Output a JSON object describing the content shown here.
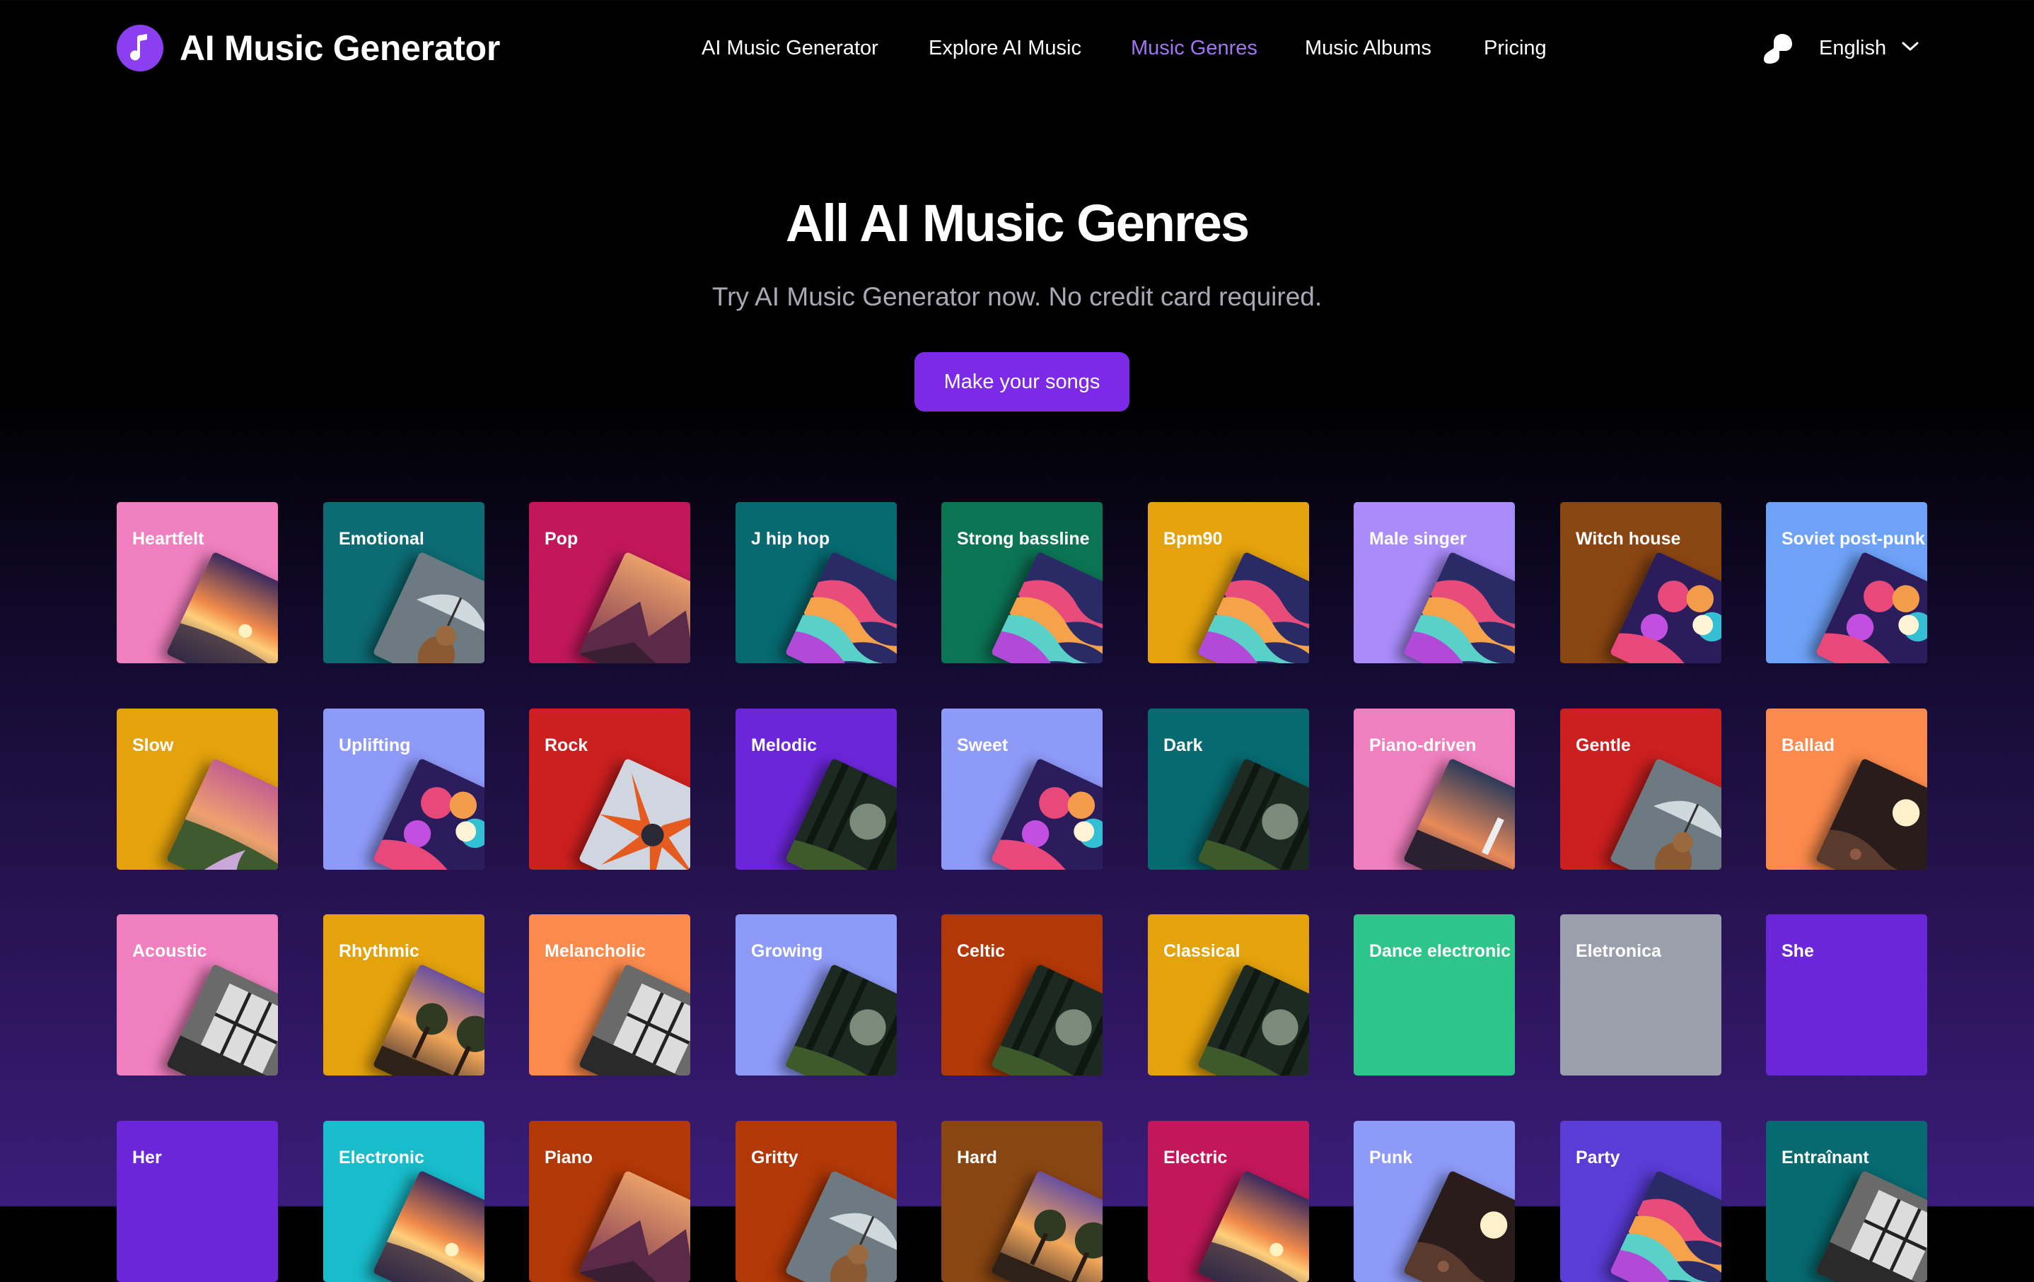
{
  "header": {
    "brand": "AI Music Generator",
    "nav": [
      {
        "label": "AI Music Generator",
        "active": false
      },
      {
        "label": "Explore AI Music",
        "active": false
      },
      {
        "label": "Music Genres",
        "active": true
      },
      {
        "label": "Music Albums",
        "active": false
      },
      {
        "label": "Pricing",
        "active": false
      }
    ],
    "language": "English"
  },
  "hero": {
    "title": "All AI Music Genres",
    "subtitle": "Try AI Music Generator now. No credit card required.",
    "cta_label": "Make your songs"
  },
  "genres": [
    {
      "label": "Heartfelt",
      "color": "#f07fbf",
      "art": "sunset-beach"
    },
    {
      "label": "Emotional",
      "color": "#0c6b73",
      "art": "dog-umbrella"
    },
    {
      "label": "Pop",
      "color": "#c2185b",
      "art": "mountain-sunset"
    },
    {
      "label": "J hip hop",
      "color": "#066a70",
      "art": "wavy-landscape"
    },
    {
      "label": "Strong bassline",
      "color": "#0b7553",
      "art": "wavy-landscape"
    },
    {
      "label": "Bpm90",
      "color": "#e4a20c",
      "art": "wavy-landscape"
    },
    {
      "label": "Male singer",
      "color": "#a98bfa",
      "art": "wavy-landscape"
    },
    {
      "label": "Witch house",
      "color": "#8a4612",
      "art": "balloons-moon"
    },
    {
      "label": "Soviet post-punk",
      "color": "#6ea2f8",
      "art": "balloons-moon"
    },
    {
      "label": "Slow",
      "color": "#e4a20c",
      "art": "meadow-river"
    },
    {
      "label": "Uplifting",
      "color": "#8e9af8",
      "art": "balloons-moon"
    },
    {
      "label": "Rock",
      "color": "#cc1f1f",
      "art": "abstract-burst"
    },
    {
      "label": "Melodic",
      "color": "#6c26da",
      "art": "forest"
    },
    {
      "label": "Sweet",
      "color": "#8e9af8",
      "art": "balloons-moon"
    },
    {
      "label": "Dark",
      "color": "#066a70",
      "art": "forest"
    },
    {
      "label": "Piano-driven",
      "color": "#f07fbf",
      "art": "lighthouse"
    },
    {
      "label": "Gentle",
      "color": "#cc1f1f",
      "art": "dog-umbrella"
    },
    {
      "label": "Ballad",
      "color": "#fb8a4c",
      "art": "moon-rocks"
    },
    {
      "label": "Acoustic",
      "color": "#f07fbf",
      "art": "bw-window"
    },
    {
      "label": "Rhythmic",
      "color": "#e4a20c",
      "art": "sunset-trees"
    },
    {
      "label": "Melancholic",
      "color": "#fb8a4c",
      "art": "bw-window"
    },
    {
      "label": "Growing",
      "color": "#8e9af8",
      "art": "forest"
    },
    {
      "label": "Celtic",
      "color": "#b23807",
      "art": "forest"
    },
    {
      "label": "Classical",
      "color": "#e4a20c",
      "art": "forest"
    },
    {
      "label": "Dance electronic",
      "color": "#2ec58a",
      "art": "none"
    },
    {
      "label": "Eletronica",
      "color": "#9aa0ab",
      "art": "none"
    },
    {
      "label": "She",
      "color": "#6c26da",
      "art": "none"
    },
    {
      "label": "Her",
      "color": "#6c26da",
      "art": "none"
    },
    {
      "label": "Electronic",
      "color": "#18bccb",
      "art": "sunset-beach"
    },
    {
      "label": "Piano",
      "color": "#b23807",
      "art": "mountain-sunset"
    },
    {
      "label": "Gritty",
      "color": "#b23807",
      "art": "dog-umbrella"
    },
    {
      "label": "Hard",
      "color": "#8a4612",
      "art": "sunset-trees"
    },
    {
      "label": "Electric",
      "color": "#c2185b",
      "art": "sunset-beach"
    },
    {
      "label": "Punk",
      "color": "#8e9af8",
      "art": "moon-rocks"
    },
    {
      "label": "Party",
      "color": "#5a3cd6",
      "art": "wavy-landscape"
    },
    {
      "label": "Entraînant",
      "color": "#066a70",
      "art": "bw-window"
    }
  ]
}
